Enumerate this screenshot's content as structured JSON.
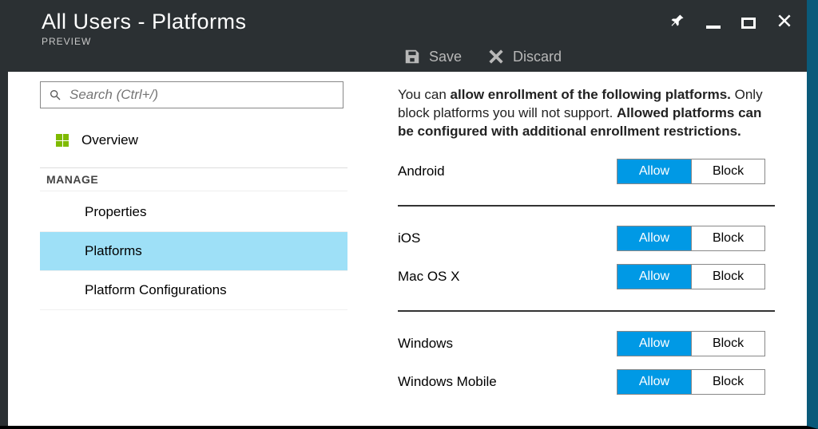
{
  "header": {
    "title": "All Users - Platforms",
    "subtitle": "PREVIEW"
  },
  "toolbar": {
    "save": "Save",
    "discard": "Discard"
  },
  "sidebar": {
    "search_placeholder": "Search (Ctrl+/)",
    "overview": "Overview",
    "section": "MANAGE",
    "items": [
      {
        "label": "Properties",
        "selected": false
      },
      {
        "label": "Platforms",
        "selected": true
      },
      {
        "label": "Platform Configurations",
        "selected": false
      }
    ]
  },
  "main": {
    "intro_pre": "You can ",
    "intro_b1": "allow enrollment of the following platforms.",
    "intro_mid": " Only block platforms you will not support. ",
    "intro_b2": "Allowed platforms can be configured with additional enrollment restrictions.",
    "allow": "Allow",
    "block": "Block",
    "groups": [
      {
        "rows": [
          {
            "label": "Android",
            "value": "allow"
          }
        ]
      },
      {
        "rows": [
          {
            "label": "iOS",
            "value": "allow"
          },
          {
            "label": "Mac OS X",
            "value": "allow"
          }
        ]
      },
      {
        "rows": [
          {
            "label": "Windows",
            "value": "allow"
          },
          {
            "label": "Windows Mobile",
            "value": "allow"
          }
        ]
      }
    ]
  }
}
